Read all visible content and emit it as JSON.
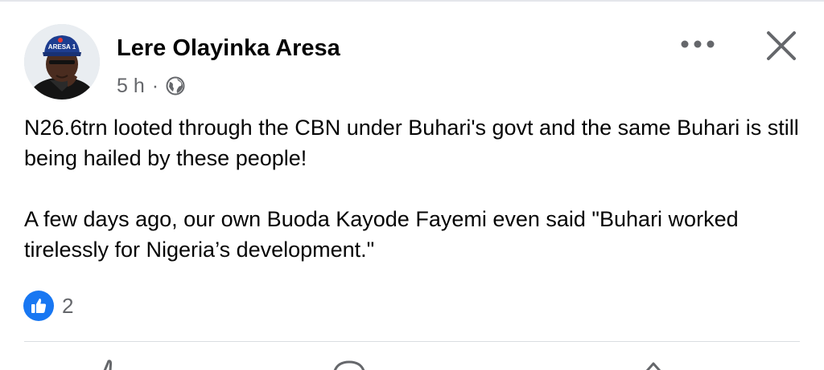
{
  "post": {
    "author": "Lere Olayinka Aresa",
    "time": "5 h",
    "separator": "·",
    "privacy_icon": "globe-icon",
    "paragraphs": [
      "N26.6trn looted through the CBN under Buhari's govt and the same Buhari is still being hailed by these people!",
      "A few days ago, our own Buoda Kayode Fayemi even said \"Buhari worked tirelessly for Nigeria’s development.\""
    ]
  },
  "avatar": {
    "cap_text": "ARESA 1"
  },
  "header_actions": {
    "more_icon": "more-horizontal-icon",
    "close_icon": "close-icon"
  },
  "reactions": {
    "icon": "like-icon",
    "count": "2"
  },
  "actions": {
    "icons": [
      "like-icon",
      "comment-icon",
      "share-icon"
    ]
  },
  "colors": {
    "like_blue": "#1877f2",
    "secondary_text": "#65676b",
    "divider": "#dadde1"
  }
}
